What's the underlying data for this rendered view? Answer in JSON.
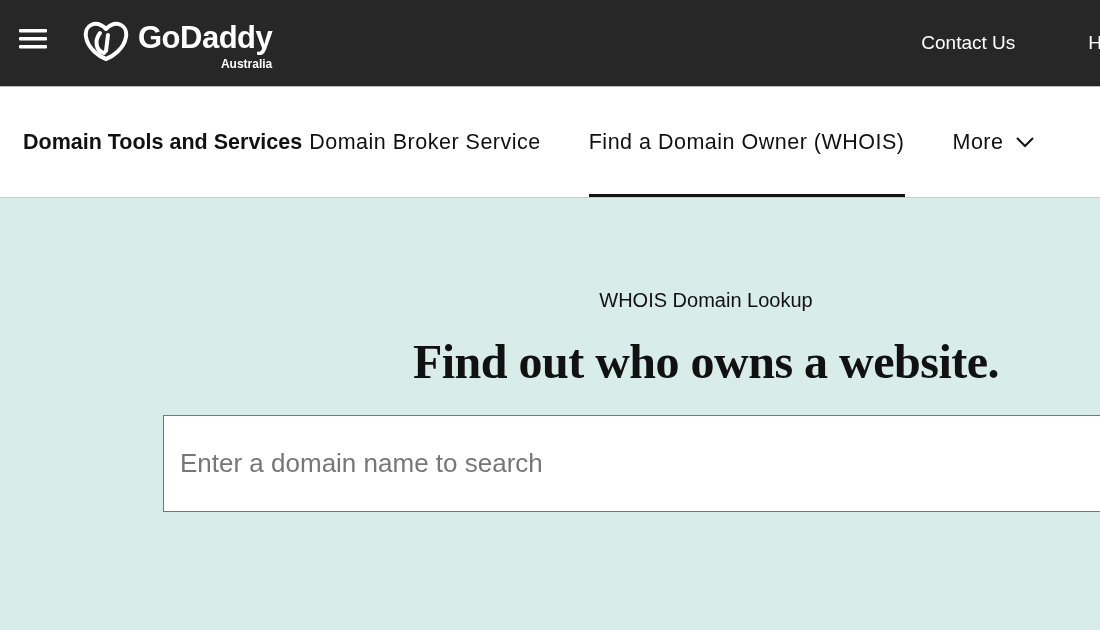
{
  "header": {
    "logo": "GoDaddy",
    "region": "Australia",
    "links": [
      "Contact Us",
      "H"
    ]
  },
  "nav": {
    "tabs": [
      {
        "label": "Domain Tools and Services",
        "selected": false,
        "kind": "heading"
      },
      {
        "label": "Domain Broker Service",
        "selected": false,
        "kind": "link"
      },
      {
        "label": "Find a Domain Owner (WHOIS)",
        "selected": true,
        "kind": "link"
      },
      {
        "label": "More",
        "selected": false,
        "kind": "dropdown"
      }
    ]
  },
  "hero": {
    "eyebrow": "WHOIS Domain Lookup",
    "title": "Find out who owns a website.",
    "search": {
      "placeholder": "Enter a domain name to search"
    }
  }
}
